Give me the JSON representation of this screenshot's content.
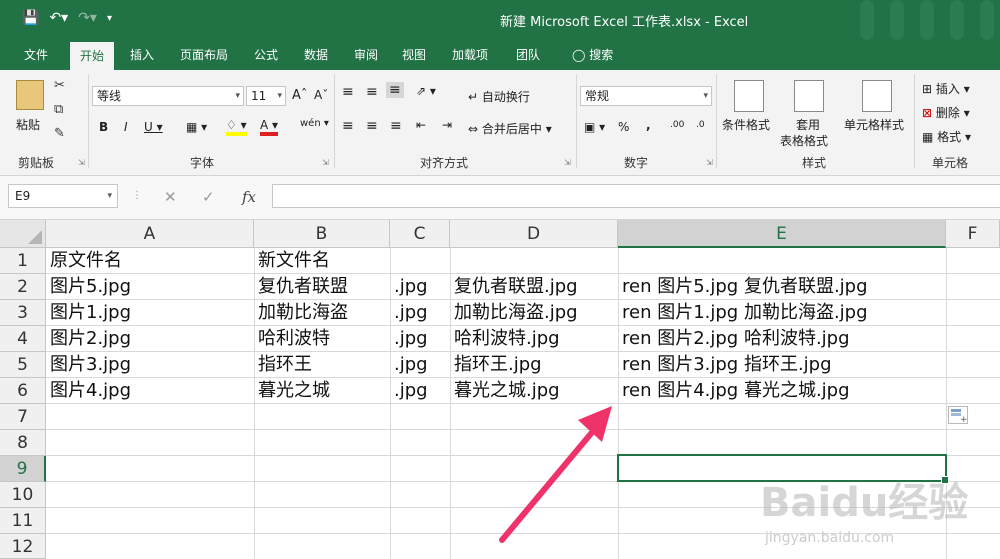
{
  "window": {
    "title": "新建 Microsoft Excel 工作表.xlsx  -  Excel"
  },
  "tabs": [
    "文件",
    "开始",
    "插入",
    "页面布局",
    "公式",
    "数据",
    "审阅",
    "视图",
    "加载项",
    "团队",
    "搜索"
  ],
  "ribbon": {
    "clipboard": {
      "paste": "粘贴",
      "label": "剪贴板"
    },
    "font": {
      "name": "等线",
      "size": "11",
      "label": "字体"
    },
    "alignment": {
      "wrap": "自动换行",
      "merge": "合并后居中",
      "label": "对齐方式"
    },
    "number": {
      "format": "常规",
      "label": "数字"
    },
    "styles": {
      "conditional": "条件格式",
      "table_line1": "套用",
      "table_line2": "表格格式",
      "cell_styles": "单元格样式",
      "label": "样式"
    },
    "cells": {
      "insert": "插入",
      "delete": "删除",
      "format": "格式",
      "label": "单元格"
    }
  },
  "formula_bar": {
    "name_box": "E9",
    "fx": "fx",
    "value": ""
  },
  "columns": [
    "A",
    "B",
    "C",
    "D",
    "E",
    "F"
  ],
  "rows": [
    "1",
    "2",
    "3",
    "4",
    "5",
    "6",
    "7",
    "8",
    "9",
    "10",
    "11",
    "12"
  ],
  "selected_cell": "E9",
  "cells": {
    "A": [
      "原文件名",
      "图片5.jpg",
      "图片1.jpg",
      "图片2.jpg",
      "图片3.jpg",
      "图片4.jpg"
    ],
    "B": [
      "新文件名",
      "复仇者联盟",
      "加勒比海盗",
      "哈利波特",
      "指环王",
      "暮光之城"
    ],
    "C": [
      "",
      ".jpg",
      ".jpg",
      ".jpg",
      ".jpg",
      ".jpg"
    ],
    "D": [
      "",
      "复仇者联盟.jpg",
      "加勒比海盗.jpg",
      "哈利波特.jpg",
      "指环王.jpg",
      "暮光之城.jpg"
    ],
    "E": [
      "",
      "ren 图片5.jpg 复仇者联盟.jpg",
      "ren 图片1.jpg 加勒比海盗.jpg",
      "ren 图片2.jpg 哈利波特.jpg",
      "ren 图片3.jpg 指环王.jpg",
      "ren 图片4.jpg 暮光之城.jpg"
    ]
  },
  "colors": {
    "excel_green": "#217346",
    "arrow": "#f0326a"
  },
  "watermark": {
    "text": "Baidu经验",
    "url": "jingyan.baidu.com"
  }
}
